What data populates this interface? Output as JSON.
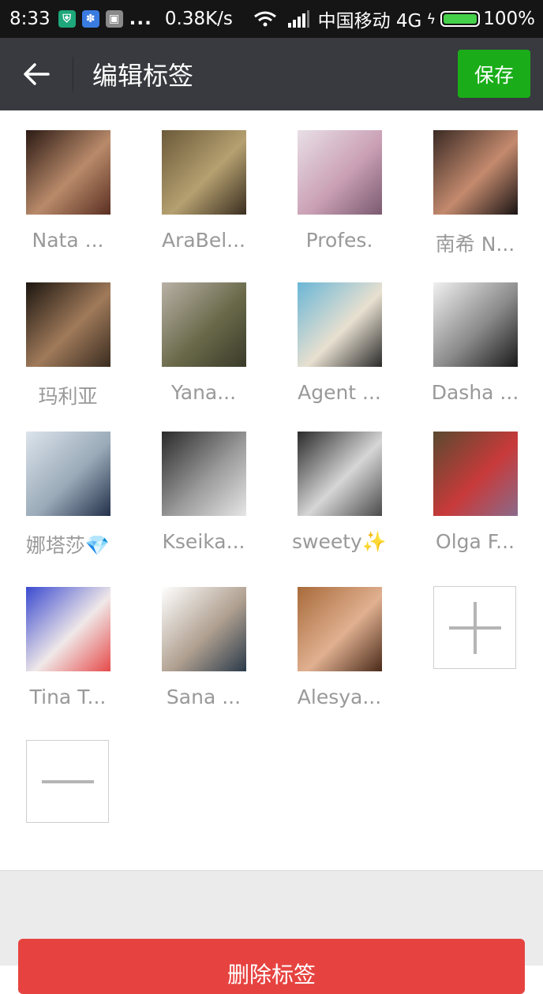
{
  "status_bar": {
    "time": "8:33",
    "speed": "0.38K/s",
    "carrier": "中国移动 4G",
    "battery": "100%",
    "battery_level": 1.0,
    "dots": "..."
  },
  "header": {
    "title": "编辑标签",
    "save_label": "保存"
  },
  "members": [
    {
      "name": "Nata ...",
      "colors": [
        "#2b1a14",
        "#b98a6a",
        "#5a2f22"
      ]
    },
    {
      "name": "AraBel...",
      "colors": [
        "#6b5a3a",
        "#b5a070",
        "#3a2e20"
      ]
    },
    {
      "name": "Profes.",
      "colors": [
        "#e8dfe6",
        "#caa0b5",
        "#7a5a70"
      ]
    },
    {
      "name": "南希  N...",
      "colors": [
        "#3a2a24",
        "#c48a6e",
        "#1a1414"
      ]
    },
    {
      "name": "玛利亚",
      "colors": [
        "#1c1610",
        "#a07a5a",
        "#3a2c20"
      ]
    },
    {
      "name": "Yana...",
      "colors": [
        "#b8b0a6",
        "#6a6a4a",
        "#3a3a2a"
      ]
    },
    {
      "name": "Agent ...",
      "colors": [
        "#6ab6d6",
        "#e8e0d0",
        "#2a2a2a"
      ]
    },
    {
      "name": "Dasha ...",
      "colors": [
        "#f0f0f0",
        "#8a8a8a",
        "#1a1a1a"
      ]
    },
    {
      "name": "娜塔莎💎",
      "colors": [
        "#dce4ec",
        "#9aaab8",
        "#23304a"
      ]
    },
    {
      "name": "Kseika...",
      "colors": [
        "#2a2a2a",
        "#9a9a9a",
        "#e6e6e6"
      ]
    },
    {
      "name": "sweety✨",
      "colors": [
        "#2a2a2a",
        "#d6d6d6",
        "#4a4a4a"
      ]
    },
    {
      "name": "Olga F...",
      "colors": [
        "#5a4a30",
        "#c83a3a",
        "#8a6a8a"
      ]
    },
    {
      "name": "Tina T...",
      "colors": [
        "#3a4ad0",
        "#f0e8e8",
        "#e64a4a"
      ]
    },
    {
      "name": "Sana ...",
      "colors": [
        "#ffffff",
        "#b0a090",
        "#2a3a4a"
      ]
    },
    {
      "name": "Alesya...",
      "colors": [
        "#a86a3a",
        "#e0b090",
        "#4a2a1a"
      ]
    }
  ],
  "add_button": {
    "icon": "plus-icon"
  },
  "remove_button": {
    "icon": "minus-icon"
  },
  "delete_button": {
    "label": "删除标签"
  },
  "colors": {
    "status_bar": "#151515",
    "header_bg": "#393a3f",
    "save_green": "#1aad19",
    "delete_red": "#e64340",
    "name_gray": "#999999"
  }
}
